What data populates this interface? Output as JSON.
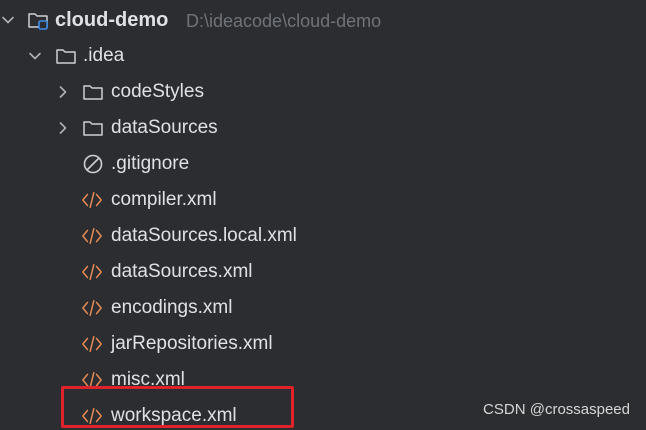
{
  "tree": {
    "root": {
      "name": "cloud-demo",
      "path": "D:\\ideacode\\cloud-demo",
      "expanded": true
    },
    "idea_folder": {
      "name": ".idea",
      "expanded": true
    },
    "folders": [
      {
        "name": "codeStyles",
        "expanded": false
      },
      {
        "name": "dataSources",
        "expanded": false
      }
    ],
    "files": [
      {
        "name": ".gitignore",
        "icon": "ignore-file-icon"
      },
      {
        "name": "compiler.xml",
        "icon": "xml-file-icon"
      },
      {
        "name": "dataSources.local.xml",
        "icon": "xml-file-icon"
      },
      {
        "name": "dataSources.xml",
        "icon": "xml-file-icon"
      },
      {
        "name": "encodings.xml",
        "icon": "xml-file-icon"
      },
      {
        "name": "jarRepositories.xml",
        "icon": "xml-file-icon"
      },
      {
        "name": "misc.xml",
        "icon": "xml-file-icon"
      },
      {
        "name": "workspace.xml",
        "icon": "xml-file-icon",
        "highlighted": true
      }
    ]
  },
  "watermark": "CSDN @crossaspeed",
  "colors": {
    "background": "#2b2d30",
    "text": "#dfe1e5",
    "path_text": "#6f737a",
    "xml_icon": "#e08855",
    "highlight": "#e0232b",
    "module_badge": "#3d8de8"
  }
}
